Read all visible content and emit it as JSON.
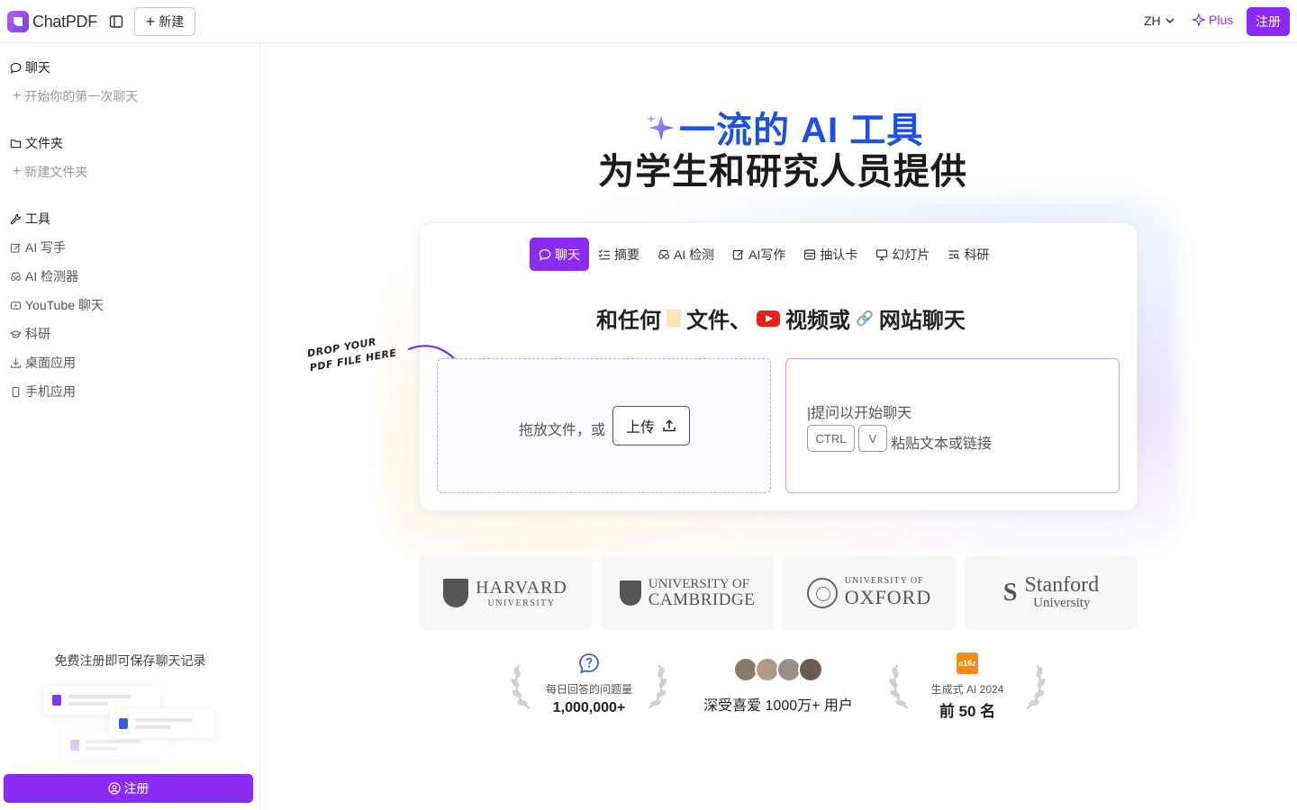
{
  "header": {
    "logo_text": "ChatPDF",
    "new_label": "新建",
    "lang": "ZH",
    "plus_label": "Plus",
    "register_label": "注册"
  },
  "sidebar": {
    "chat_title": "聊天",
    "chat_new": "开始你的第一次聊天",
    "folder_title": "文件夹",
    "folder_new": "新建文件夹",
    "tools_title": "工具",
    "tools": [
      {
        "label": "AI 写手",
        "icon": "edit-icon"
      },
      {
        "label": "AI 检测器",
        "icon": "detector-icon"
      },
      {
        "label": "YouTube 聊天",
        "icon": "youtube-icon"
      },
      {
        "label": "科研",
        "icon": "graduation-cap-icon"
      },
      {
        "label": "桌面应用",
        "icon": "download-icon"
      },
      {
        "label": "手机应用",
        "icon": "phone-icon"
      }
    ],
    "save_note": "免费注册即可保存聊天记录",
    "register_label": "注册"
  },
  "hero": {
    "line1": "一流的 AI 工具",
    "line2": "为学生和研究人员提供"
  },
  "tabs": [
    {
      "label": "聊天",
      "icon": "chat-icon",
      "active": true
    },
    {
      "label": "摘要",
      "icon": "list-check-icon",
      "active": false
    },
    {
      "label": "AI 检测",
      "icon": "detector-icon",
      "active": false
    },
    {
      "label": "AI写作",
      "icon": "edit-icon",
      "active": false
    },
    {
      "label": "抽认卡",
      "icon": "flashcard-icon",
      "active": false
    },
    {
      "label": "幻灯片",
      "icon": "presentation-icon",
      "active": false
    },
    {
      "label": "科研",
      "icon": "research-icon",
      "active": false
    }
  ],
  "chat_any": {
    "part1": "和任何",
    "part2": "文件、",
    "part3": "视频或",
    "part4": "网站聊天"
  },
  "upload": {
    "drop_text": "拖放文件，或",
    "upload_label": "上传",
    "drop_hint_line1": "DROP YOUR",
    "drop_hint_line2": "PDF FILE HERE"
  },
  "paste": {
    "placeholder": "提问以开始聊天",
    "key1": "CTRL",
    "key2": "V",
    "hint": "粘贴文本或链接"
  },
  "universities": [
    {
      "name": "HARVARD",
      "sub": "UNIVERSITY"
    },
    {
      "name": "UNIVERSITY OF",
      "sub": "CAMBRIDGE"
    },
    {
      "name": "UNIVERSITY OF",
      "sub": "OXFORD"
    },
    {
      "name": "Stanford",
      "sub": "University"
    }
  ],
  "stats": {
    "questions_label": "每日回答的问题量",
    "questions_value": "1,000,000+",
    "users_text": "深受喜爱 1000万+ 用户",
    "a16z_badge": "a16z",
    "a16z_label": "生成式 AI 2024",
    "a16z_value": "前 50 名"
  },
  "colors": {
    "accent": "#8b2cf5",
    "hero_blue": "#1e50e6"
  }
}
